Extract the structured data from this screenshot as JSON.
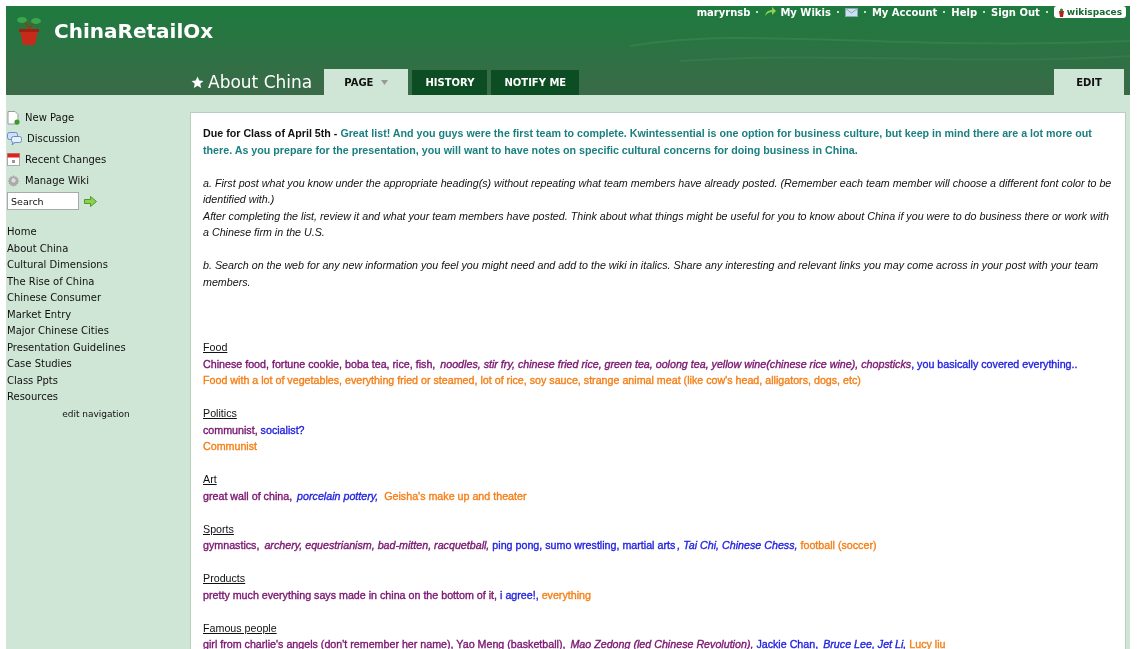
{
  "site": {
    "title": "ChinaRetailOx"
  },
  "user_bar": {
    "username": "maryrnsb",
    "links": [
      "My Wikis",
      "My Account",
      "Help",
      "Sign Out"
    ],
    "badge": "wikispaces"
  },
  "page": {
    "title": "About China"
  },
  "tabs": [
    {
      "label": "PAGE",
      "selected": true,
      "dropdown": true
    },
    {
      "label": "HISTORY",
      "selected": false,
      "dropdown": false
    },
    {
      "label": "NOTIFY ME",
      "selected": false,
      "dropdown": false
    }
  ],
  "edit_button": "EDIT",
  "sidebar": {
    "actions": [
      {
        "label": "New Page",
        "kind": "page"
      },
      {
        "label": "Discussion",
        "kind": "discussion"
      },
      {
        "label": "Recent Changes",
        "kind": "calendar"
      },
      {
        "label": "Manage Wiki",
        "kind": "gear"
      }
    ],
    "search": {
      "placeholder": "Search"
    },
    "nav": [
      "Home",
      "About China",
      "Cultural Dimensions",
      "The Rise of China",
      "Chinese Consumer",
      "Market Entry",
      "Major Chinese Cities",
      "Presentation Guidelines",
      "Case Studies",
      "Class Ppts",
      "Resources"
    ],
    "edit_link": "edit navigation"
  },
  "intro": {
    "label": "Due for Class of April 5th -",
    "comment": "Great list! And you guys were the first team to complete. Kwintessential is one option for business culture, but keep in mind there are a lot more out there. As you prepare for the presentation, you will want to have notes on specific cultural concerns for doing business in China.",
    "instructions": [
      "a. First post what you know under the appropriate heading(s) without repeating what team members have already posted. (Remember each team member will choose a different font color to be identified with.)\nAfter completing the list, review it and what your team members have posted. Think about what things might be useful for you to know about China if you were to do business there or work with a Chinese firm in the U.S.",
      "b. Search on the web for any new information you feel you might need and add to the wiki in italics. Share any interesting and relevant links you may come across in your post with your team members."
    ]
  },
  "sections": [
    {
      "heading": "Food",
      "lines": [
        [
          {
            "text": "Chinese food, fortune cookie, boba tea, rice, fish, ",
            "color": "#7a1470",
            "italic": false
          },
          {
            "text": "noodles, stir fry, chinese fried rice, green tea, oolong tea, yellow wine(chinese rice wine), chopsticks",
            "color": "#7a1470",
            "italic": true
          },
          {
            "text": ", you basically covered everything..",
            "color": "#1f1fe0",
            "italic": false
          }
        ],
        [
          {
            "text": "Food with a lot of vegetables, everything fried or steamed, lot of rice, soy sauce, strange animal meat (like cow's head, alligators, dogs, etc)",
            "color": "#f57f17",
            "italic": false
          }
        ]
      ]
    },
    {
      "heading": "Politics",
      "lines": [
        [
          {
            "text": "communist, ",
            "color": "#7a1470",
            "italic": false
          },
          {
            "text": "socialist?",
            "color": "#1f1fe0",
            "italic": false
          }
        ],
        [
          {
            "text": "Communist",
            "color": "#f57f17",
            "italic": false
          }
        ]
      ]
    },
    {
      "heading": "Art",
      "lines": [
        [
          {
            "text": "great wall of china, ",
            "color": "#7a1470",
            "italic": false
          },
          {
            "text": "porcelain pottery, ",
            "color": "#1f1fe0",
            "italic": true
          },
          {
            "text": " Geisha's make up and theater",
            "color": "#f57f17",
            "italic": false
          }
        ]
      ]
    },
    {
      "heading": "Sports",
      "lines": [
        [
          {
            "text": "gymnastics, ",
            "color": "#7a1470",
            "italic": false
          },
          {
            "text": "archery, equestrianism, bad-mitten, racquetball,",
            "color": "#7a1470",
            "italic": true
          },
          {
            "text": " ping pong, sumo wrestling, martial arts",
            "color": "#1f1fe0",
            "italic": false
          },
          {
            "text": ", Tai Chi, Chinese Chess,",
            "color": "#1f1fe0",
            "italic": true
          },
          {
            "text": " football (soccer)",
            "color": "#f57f17",
            "italic": false
          }
        ]
      ]
    },
    {
      "heading": "Products",
      "lines": [
        [
          {
            "text": "pretty much everything says made in china on the bottom of it, ",
            "color": "#7a1470",
            "italic": false
          },
          {
            "text": "i agree!, ",
            "color": "#1f1fe0",
            "italic": false
          },
          {
            "text": "everything",
            "color": "#f57f17",
            "italic": false
          }
        ]
      ]
    },
    {
      "heading": "Famous people",
      "lines": [
        [
          {
            "text": "girl from charlie's angels (don't remember her name), Yao Meng (basketball), ",
            "color": "#7a1470",
            "italic": false
          },
          {
            "text": "Mao Zedong (led Chinese Revolution),",
            "color": "#7a1470",
            "italic": true
          },
          {
            "text": " Jackie Chan, ",
            "color": "#1f1fe0",
            "italic": false
          },
          {
            "text": "Bruce Lee, Jet Li,",
            "color": "#1f1fe0",
            "italic": true
          },
          {
            "text": " Lucy liu",
            "color": "#f57f17",
            "italic": false
          }
        ]
      ]
    }
  ]
}
